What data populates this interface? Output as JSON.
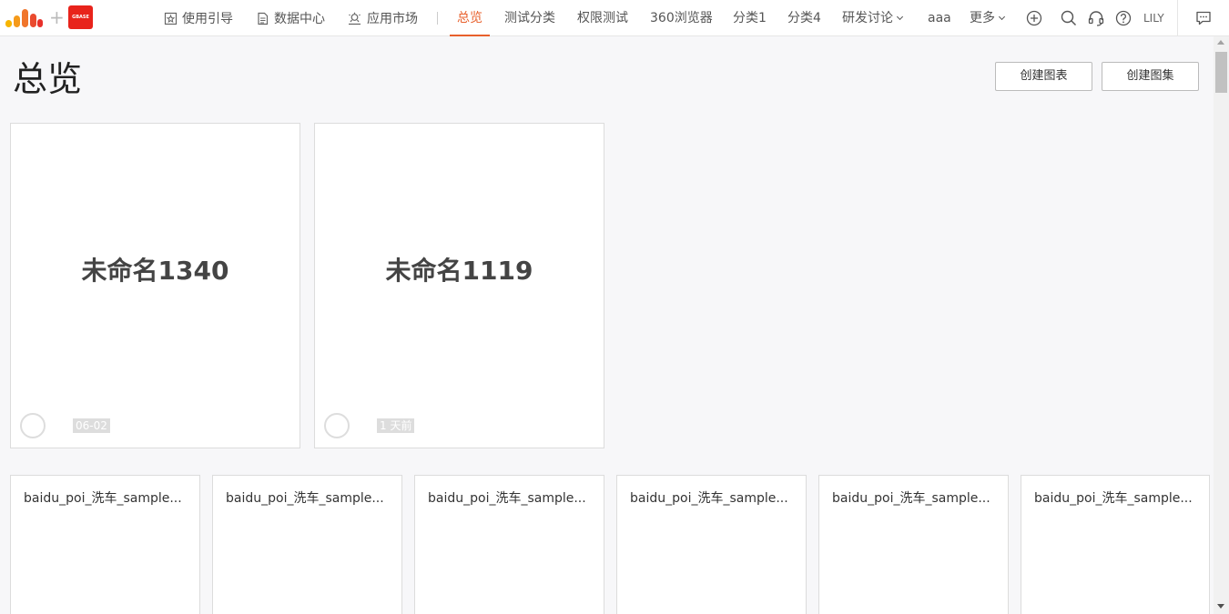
{
  "brand": {
    "logo_icon": "bar-logo-icon",
    "plus": "+",
    "badge_text": "GBASE",
    "colors": {
      "accent": "#e8602c",
      "badge": "#e8231b"
    }
  },
  "nav_left": [
    {
      "label": "使用引导",
      "icon": "star-doc-icon"
    },
    {
      "label": "数据中心",
      "icon": "document-icon"
    },
    {
      "label": "应用市场",
      "icon": "app-market-icon"
    }
  ],
  "tabs": [
    {
      "label": "总览",
      "active": true
    },
    {
      "label": "测试分类"
    },
    {
      "label": "权限测试"
    },
    {
      "label": "360浏览器"
    },
    {
      "label": "分类1"
    },
    {
      "label": "分类4"
    },
    {
      "label": "研发讨论",
      "dropdown": true
    },
    {
      "label": "aaa"
    },
    {
      "label": "更多",
      "dropdown": true
    }
  ],
  "right_icons": [
    "plus-circle-icon",
    "search-icon",
    "headset-icon",
    "help-icon",
    "chat-icon"
  ],
  "user": {
    "name": "LILY"
  },
  "page": {
    "title": "总览",
    "create_chart": "创建图表",
    "create_gallery": "创建图集"
  },
  "cards": [
    {
      "name": "未命名1340",
      "date": "06-02"
    },
    {
      "name": "未命名1119",
      "date": "1 天前"
    }
  ],
  "small_cards": [
    {
      "title": "baidu_poi_洗车_sample..."
    },
    {
      "title": "baidu_poi_洗车_sample..."
    },
    {
      "title": "baidu_poi_洗车_sample..."
    },
    {
      "title": "baidu_poi_洗车_sample..."
    },
    {
      "title": "baidu_poi_洗车_sample..."
    },
    {
      "title": "baidu_poi_洗车_sample..."
    }
  ]
}
